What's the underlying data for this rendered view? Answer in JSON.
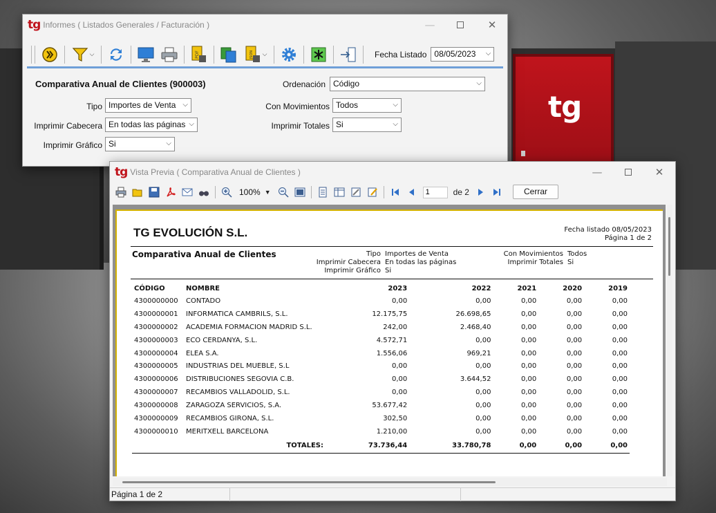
{
  "informes": {
    "title_prefix": "tg",
    "title": "Informes ( Listados Generales / Facturación )",
    "fecha_label": "Fecha Listado",
    "fecha_value": "08/05/2023",
    "report_heading": "Comparativa Anual de Clientes (900003)",
    "fields": {
      "ordenacion": {
        "label": "Ordenación",
        "value": "Código"
      },
      "tipo": {
        "label": "Tipo",
        "value": "Importes de Venta"
      },
      "con_movimientos": {
        "label": "Con Movimientos",
        "value": "Todos"
      },
      "imprimir_cabecera": {
        "label": "Imprimir Cabecera",
        "value": "En todas las páginas"
      },
      "imprimir_totales": {
        "label": "Imprimir Totales",
        "value": "Si"
      },
      "imprimir_grafico": {
        "label": "Imprimir Gráfico",
        "value": "Si"
      }
    }
  },
  "preview": {
    "title_prefix": "tg",
    "title": "Vista Previa ( Comparativa Anual de Clientes )",
    "zoom": "100%",
    "page_current": "1",
    "page_total": "de 2",
    "close_label": "Cerrar",
    "status_text": "Página 1 de 2",
    "report": {
      "company": "TG EVOLUCIÓN S.L.",
      "fecha": "Fecha listado 08/05/2023",
      "pagina": "Página 1 de 2",
      "title": "Comparativa Anual de Clientes",
      "params": {
        "tipo_lbl": "Tipo",
        "tipo_val": "Importes de Venta",
        "cab_lbl": "Imprimir Cabecera",
        "cab_val": "En todas las páginas",
        "graf_lbl": "Imprimir Gráfico",
        "graf_val": "Si",
        "mov_lbl": "Con Movimientos",
        "mov_val": "Todos",
        "tot_lbl": "Imprimir Totales",
        "tot_val": "Si"
      },
      "columns": [
        "CÓDIGO",
        "NOMBRE",
        "2023",
        "2022",
        "2021",
        "2020",
        "2019"
      ],
      "rows": [
        [
          "4300000000",
          "CONTADO",
          "0,00",
          "0,00",
          "0,00",
          "0,00",
          "0,00"
        ],
        [
          "4300000001",
          "INFORMATICA CAMBRILS, S.L.",
          "12.175,75",
          "26.698,65",
          "0,00",
          "0,00",
          "0,00"
        ],
        [
          "4300000002",
          "ACADEMIA FORMACION MADRID S.L.",
          "242,00",
          "2.468,40",
          "0,00",
          "0,00",
          "0,00"
        ],
        [
          "4300000003",
          "ECO CERDANYA, S.L.",
          "4.572,71",
          "0,00",
          "0,00",
          "0,00",
          "0,00"
        ],
        [
          "4300000004",
          "ELEA S.A.",
          "1.556,06",
          "969,21",
          "0,00",
          "0,00",
          "0,00"
        ],
        [
          "4300000005",
          "INDUSTRIAS DEL MUEBLE, S.L",
          "0,00",
          "0,00",
          "0,00",
          "0,00",
          "0,00"
        ],
        [
          "4300000006",
          "DISTRIBUCIONES SEGOVIA C.B.",
          "0,00",
          "3.644,52",
          "0,00",
          "0,00",
          "0,00"
        ],
        [
          "4300000007",
          "RECAMBIOS VALLADOLID, S.L.",
          "0,00",
          "0,00",
          "0,00",
          "0,00",
          "0,00"
        ],
        [
          "4300000008",
          "ZARAGOZA SERVICIOS, S.A.",
          "53.677,42",
          "0,00",
          "0,00",
          "0,00",
          "0,00"
        ],
        [
          "4300000009",
          "RECAMBIOS GIRONA, S.L.",
          "302,50",
          "0,00",
          "0,00",
          "0,00",
          "0,00"
        ],
        [
          "4300000010",
          "MERITXELL BARCELONA",
          "1.210,00",
          "0,00",
          "0,00",
          "0,00",
          "0,00"
        ]
      ],
      "totals_label": "TOTALES:",
      "totals": [
        "73.736,44",
        "33.780,78",
        "0,00",
        "0,00",
        "0,00"
      ]
    }
  },
  "background": {
    "door_logo": "tg",
    "door_color": "#b0121a"
  },
  "colors": {
    "brand_red": "#c0141c",
    "accent_blue": "#6f9fd8",
    "page_border": "#d4b200"
  },
  "icons": {
    "informes_toolbar": [
      "execute-icon",
      "filter-icon",
      "refresh-icon",
      "monitor-icon",
      "printer-icon",
      "pdf-icon",
      "copy-icon",
      "json-icon",
      "settings-icon",
      "asterisk-icon",
      "exit-icon"
    ],
    "preview_toolbar": [
      "print-icon",
      "open-icon",
      "save-icon",
      "pdf-icon",
      "email-icon",
      "find-icon",
      "zoom-in-icon",
      "zoom-out-icon",
      "page-fit-icon",
      "page-setup-icon",
      "columns-icon",
      "tools-icon",
      "edit-icon",
      "first-page-icon",
      "prev-page-icon",
      "next-page-icon",
      "last-page-icon"
    ]
  }
}
